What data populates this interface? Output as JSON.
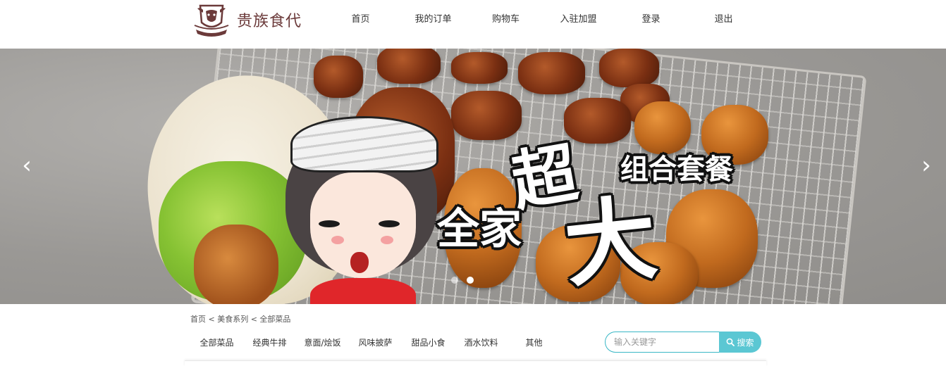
{
  "brand": {
    "name": "贵族食代",
    "logo_icon": "bull-head-crest-icon",
    "color": "#6b3a3a"
  },
  "nav": {
    "items": [
      {
        "label": "首页"
      },
      {
        "label": "我的订单"
      },
      {
        "label": "购物车"
      },
      {
        "label": "入驻加盟"
      },
      {
        "label": "登录"
      },
      {
        "label": "退出"
      }
    ]
  },
  "banner": {
    "headline_chao": "超",
    "headline_combo": "组合套餐",
    "headline_family": "全家",
    "headline_da": "大",
    "prev_icon": "chevron-left-icon",
    "next_icon": "chevron-right-icon",
    "prev_glyph": "‹",
    "next_glyph": "›",
    "slide_count": 2,
    "active_slide": 1
  },
  "breadcrumb": {
    "text": "首页 < 美食系列 < 全部菜品"
  },
  "categories": {
    "items": [
      {
        "label": "全部菜品"
      },
      {
        "label": "经典牛排"
      },
      {
        "label": "意面/烩饭"
      },
      {
        "label": "风味披萨"
      },
      {
        "label": "甜品小食"
      },
      {
        "label": "酒水饮料"
      },
      {
        "label": "其他"
      }
    ]
  },
  "search": {
    "placeholder": "输入关键字",
    "value": "",
    "button_label": "搜索",
    "button_icon": "search-icon",
    "accent_color": "#5bc7d3"
  }
}
